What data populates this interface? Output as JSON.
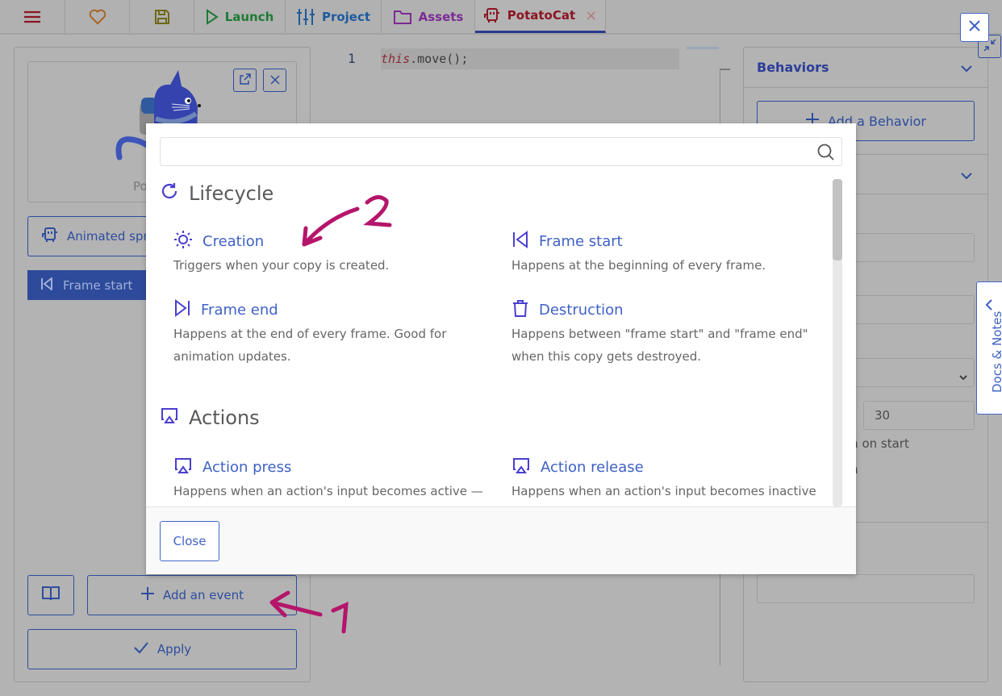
{
  "toolbar": {
    "menu_icon": "hamburger-icon",
    "favorites_icon": "heart-icon",
    "save_icon": "floppy-disk-icon",
    "launch_label": "Launch",
    "project_label": "Project",
    "assets_label": "Assets",
    "tab_label": "PotatoCat",
    "tab_close": "×"
  },
  "window": {
    "close_icon": "close-icon",
    "restore_icon": "minimize-arrows-icon"
  },
  "left_panel": {
    "preview_name": "Po",
    "template_label": "Animated spr",
    "selected_event": "Frame start",
    "add_event_label": "Add an event",
    "apply_label": "Apply"
  },
  "editor": {
    "line_number": "1",
    "code_keyword": "this",
    "code_rest": ".move();"
  },
  "right_panel": {
    "behaviors_header": "Behaviors",
    "add_behavior_label": "Add a Behavior",
    "fps_value": "30",
    "checkbox1_partial": "on on start",
    "checkbox2_partial": "on",
    "docs_tab_label": "Docs & Notes"
  },
  "modal": {
    "search_placeholder": "",
    "search_value": "",
    "sections": [
      {
        "title": "Lifecycle",
        "icon": "refresh-icon",
        "items": [
          {
            "title": "Creation",
            "icon": "sun-icon",
            "description": "Triggers when your copy is created."
          },
          {
            "title": "Frame start",
            "icon": "skip-back-icon",
            "description": "Happens at the beginning of every frame."
          },
          {
            "title": "Frame end",
            "icon": "skip-forward-icon",
            "description": "Happens at the end of every frame. Good for animation updates."
          },
          {
            "title": "Destruction",
            "icon": "trash-icon",
            "description": "Happens between \"frame start\" and \"frame end\" when this copy gets destroyed."
          }
        ]
      },
      {
        "title": "Actions",
        "icon": "airplay-icon",
        "items": [
          {
            "title": "Action press",
            "icon": "airplay-icon",
            "description": "Happens when an action's input becomes active —"
          },
          {
            "title": "Action release",
            "icon": "airplay-icon",
            "description": "Happens when an action's input becomes inactive"
          }
        ]
      }
    ],
    "close_label": "Close"
  },
  "annotations": {
    "one": "1",
    "two": "2",
    "color": "#b5156b"
  },
  "colors": {
    "accent": "#3f61c5",
    "overlay": "#b3b3b3",
    "tab_accent": "#8b1522"
  }
}
